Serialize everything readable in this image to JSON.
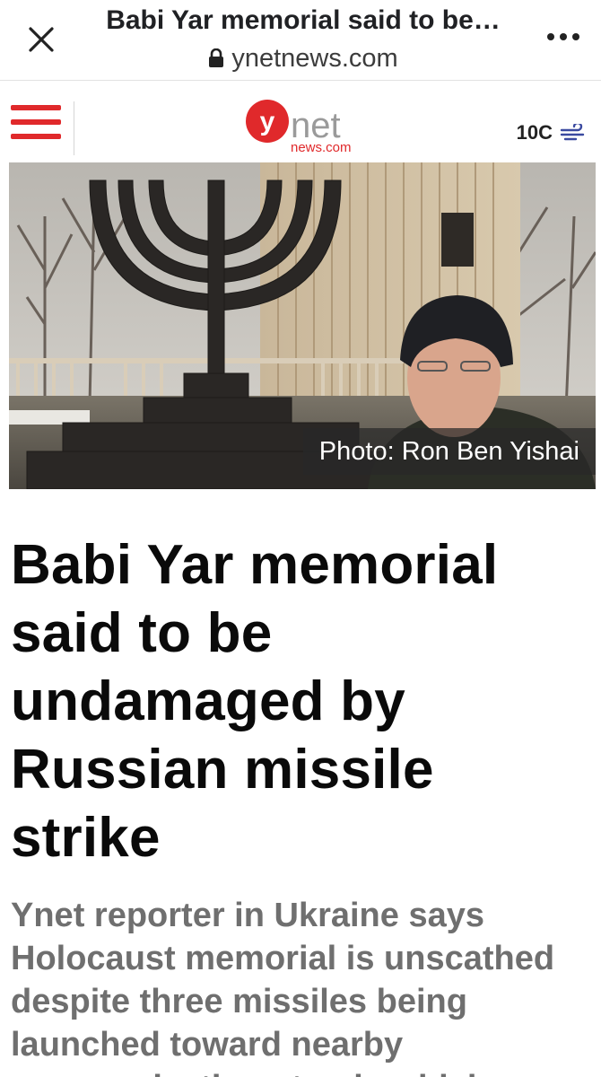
{
  "browser": {
    "page_title": "Babi Yar memorial said to be…",
    "url": "ynetnews.com",
    "close_icon": "close-icon",
    "lock_icon": "lock-icon",
    "menu_icon": "more-dots-icon"
  },
  "site_header": {
    "menu_icon": "hamburger-menu-icon",
    "logo": {
      "y": "y",
      "net": "net",
      "news": "news.com"
    },
    "weather": {
      "temperature": "10C",
      "icon": "wind-icon"
    }
  },
  "article": {
    "photo_credit": "Photo: Ron Ben Yishai",
    "headline": "Babi Yar memorial said to be undamaged by Russian missile strike",
    "subheadline": "Ynet reporter in Ukraine says Holocaust memorial is unscathed despite three missiles being launched toward nearby communication stands which"
  },
  "colors": {
    "brand_red": "#e0292b",
    "headline": "#0a0a0a",
    "subheadline": "#6f6f6f"
  }
}
